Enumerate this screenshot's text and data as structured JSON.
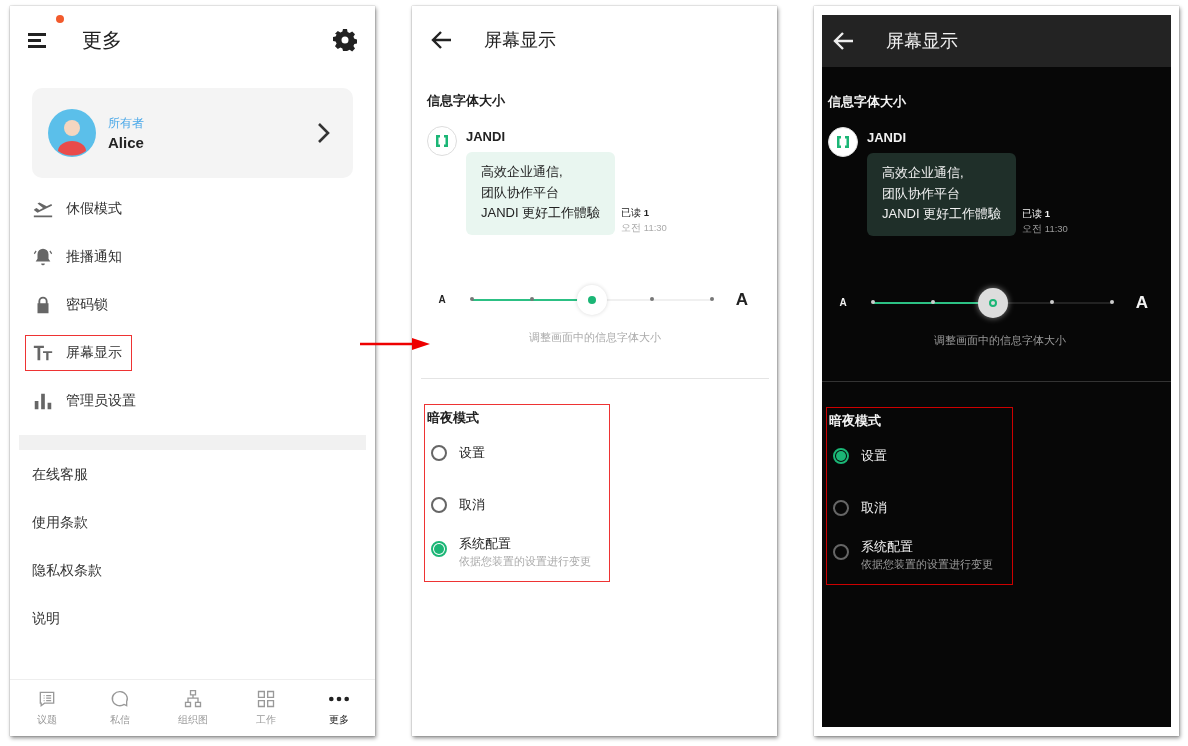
{
  "more_screen": {
    "title": "更多",
    "profile": {
      "role": "所有者",
      "name": "Alice"
    },
    "menu_items": [
      {
        "kind": "vacation",
        "label": "休假模式",
        "highlighted": false
      },
      {
        "kind": "push",
        "label": "推播通知",
        "highlighted": false
      },
      {
        "kind": "lock",
        "label": "密码锁",
        "highlighted": false
      },
      {
        "kind": "display",
        "label": "屏幕显示",
        "highlighted": true
      },
      {
        "kind": "admin",
        "label": "管理员设置",
        "highlighted": false
      }
    ],
    "links": [
      "在线客服",
      "使用条款",
      "隐私权条款",
      "说明"
    ],
    "bottom_nav": [
      {
        "kind": "topics",
        "label": "议题",
        "selected": false
      },
      {
        "kind": "messages",
        "label": "私信",
        "selected": false
      },
      {
        "kind": "org",
        "label": "组织图",
        "selected": false
      },
      {
        "kind": "work",
        "label": "工作",
        "selected": false
      },
      {
        "kind": "more",
        "label": "更多",
        "selected": true
      }
    ]
  },
  "display_screens": [
    {
      "kind": "light",
      "title": "屏幕显示",
      "section_title": "信息字体大小",
      "message": {
        "sender": "JANDI",
        "lines": [
          "高效企业通信,",
          "团队协作平台",
          "JANDI 更好工作體驗"
        ],
        "read_label": "已读",
        "read_count": "1",
        "time": "오전 11:30"
      },
      "slider": {
        "small_label": "A",
        "large_label": "A",
        "level": 0.5,
        "caption": "调整画面中的信息字体大小"
      },
      "dark_mode": {
        "title": "暗夜模式",
        "highlighted": true,
        "options": [
          {
            "label": "设置",
            "selected": false
          },
          {
            "label": "取消",
            "selected": false
          },
          {
            "label": "系统配置",
            "description": "依据您装置的设置进行变更",
            "selected": true
          }
        ]
      }
    },
    {
      "kind": "dark",
      "title": "屏幕显示",
      "section_title": "信息字体大小",
      "message": {
        "sender": "JANDI",
        "lines": [
          "高效企业通信,",
          "团队协作平台",
          "JANDI 更好工作體驗"
        ],
        "read_label": "已读",
        "read_count": "1",
        "time": "오전 11:30"
      },
      "slider": {
        "small_label": "A",
        "large_label": "A",
        "level": 0.5,
        "caption": "调整画面中的信息字体大小"
      },
      "dark_mode": {
        "title": "暗夜模式",
        "highlighted": true,
        "options": [
          {
            "label": "设置",
            "selected": true
          },
          {
            "label": "取消",
            "selected": false
          },
          {
            "label": "系统配置",
            "description": "依据您装置的设置进行变更",
            "selected": false
          }
        ]
      }
    }
  ]
}
